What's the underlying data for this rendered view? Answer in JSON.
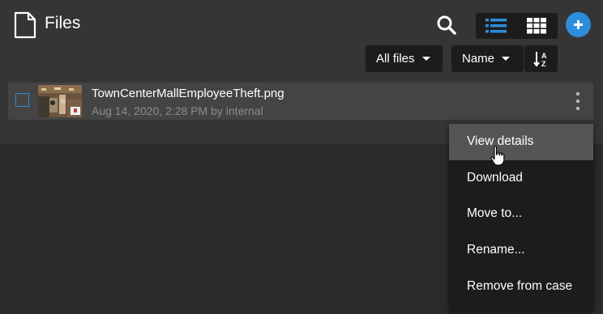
{
  "header": {
    "title": "Files",
    "icons": {
      "title": "file-icon",
      "search": "search-icon",
      "list_view": "list-view-icon",
      "grid_view": "grid-view-icon",
      "add": "plus-icon",
      "sort_direction": "sort-alpha-down-icon"
    },
    "active_view": "list",
    "accent_color": "#2b8ddb"
  },
  "toolbar": {
    "filter_label": "All files",
    "sort_label": "Name",
    "sort_direction_label": "A-Z"
  },
  "files": [
    {
      "name": "TownCenterMallEmployeeTheft.png",
      "meta": "Aug 14, 2020, 2:28 PM by internal",
      "selected": false
    }
  ],
  "context_menu": {
    "items": [
      {
        "label": "View details",
        "active": true
      },
      {
        "label": "Download"
      },
      {
        "label": "Move to..."
      },
      {
        "label": "Rename..."
      },
      {
        "label": "Remove from case"
      }
    ]
  },
  "cursor": "hand-pointer-icon"
}
